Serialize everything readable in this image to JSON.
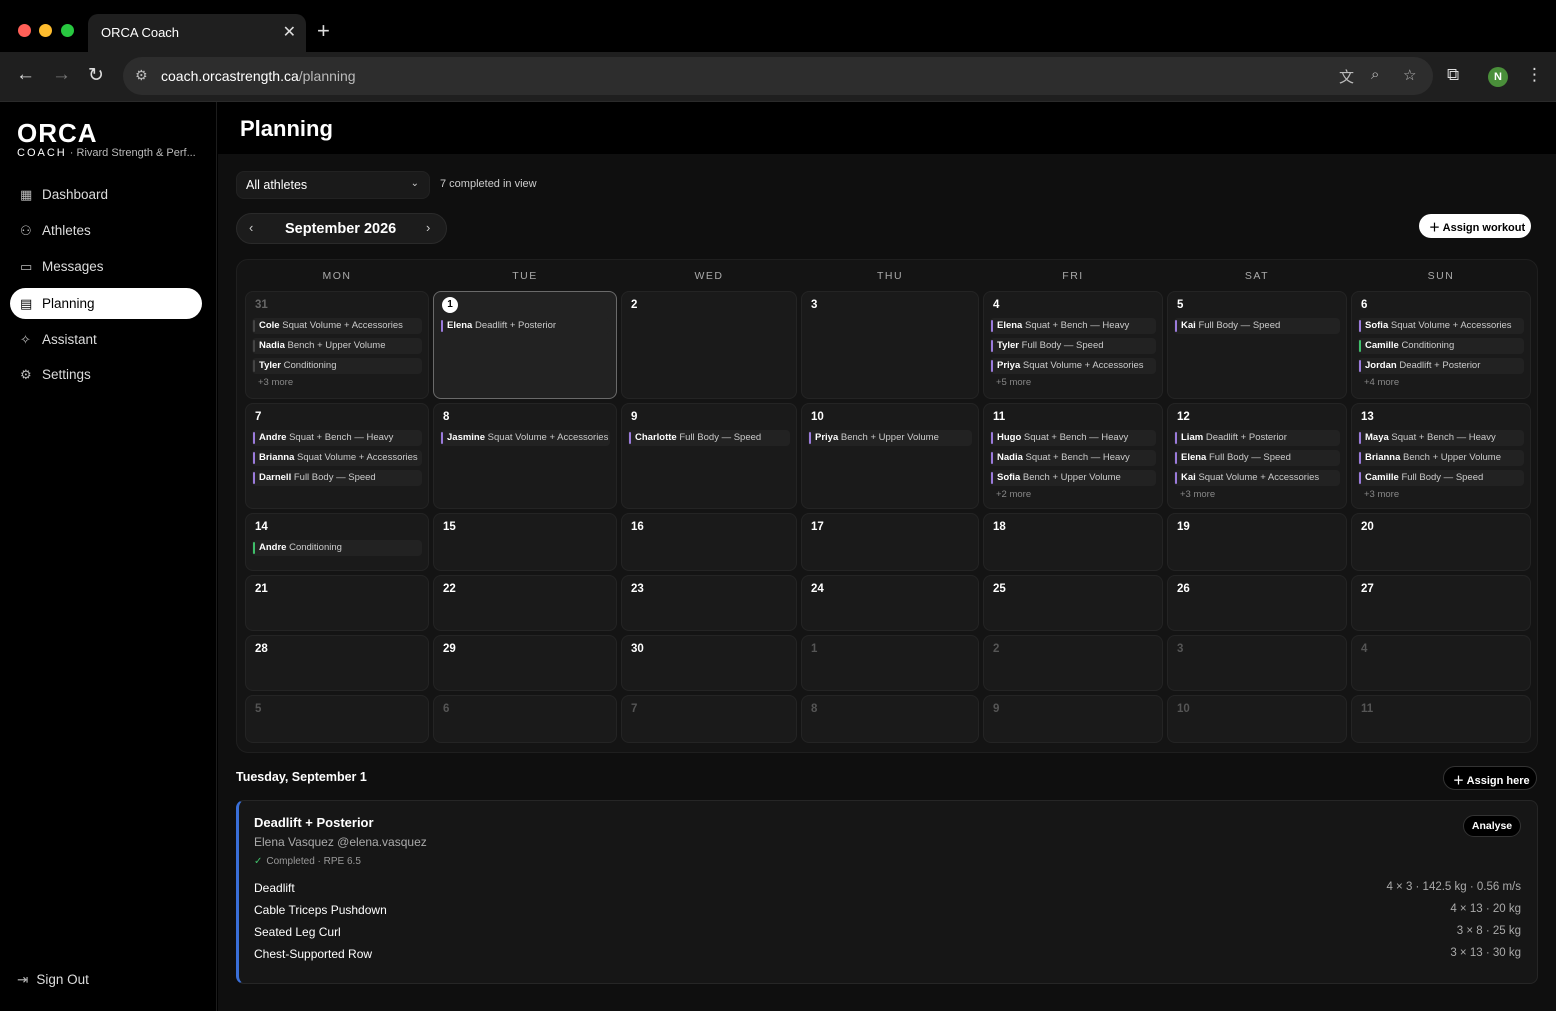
{
  "browser": {
    "tab_title": "ORCA Coach",
    "url_host": "coach.orcastrength.ca",
    "url_path": "/planning",
    "profile_initial": "N"
  },
  "sidebar": {
    "logo": "ORCA",
    "coach_label": "COACH",
    "org": "· Rivard Strength & Perf...",
    "items": [
      {
        "label": "Dashboard",
        "icon": "dashboard-icon"
      },
      {
        "label": "Athletes",
        "icon": "users-icon"
      },
      {
        "label": "Messages",
        "icon": "message-icon"
      },
      {
        "label": "Planning",
        "icon": "calendar-icon",
        "active": true
      },
      {
        "label": "Assistant",
        "icon": "sparkle-icon"
      },
      {
        "label": "Settings",
        "icon": "gear-icon"
      }
    ],
    "signout": "Sign Out"
  },
  "main": {
    "title": "Planning",
    "athlete_filter": "All athletes",
    "completed_text": "7 completed in view",
    "month": "September 2026",
    "assign_workout": "Assign workout"
  },
  "calendar": {
    "weekdays": [
      "MON",
      "TUE",
      "WED",
      "THU",
      "FRI",
      "SAT",
      "SUN"
    ],
    "weeks": [
      [
        {
          "day": "31",
          "state": "prev",
          "events": [
            {
              "athlete": "Cole",
              "workout": "Squat Volume + Accessories",
              "style": "plain"
            },
            {
              "athlete": "Nadia",
              "workout": "Bench + Upper Volume",
              "style": "plain"
            },
            {
              "athlete": "Tyler",
              "workout": "Conditioning",
              "style": "plain"
            }
          ],
          "more": "+3 more"
        },
        {
          "day": "1",
          "state": "today",
          "events": [
            {
              "athlete": "Elena",
              "workout": "Deadlift + Posterior",
              "style": "purple"
            }
          ],
          "more": ""
        },
        {
          "day": "2",
          "events": [],
          "more": ""
        },
        {
          "day": "3",
          "events": [],
          "more": ""
        },
        {
          "day": "4",
          "events": [
            {
              "athlete": "Elena",
              "workout": "Squat + Bench — Heavy",
              "style": "purple"
            },
            {
              "athlete": "Tyler",
              "workout": "Full Body — Speed",
              "style": "purple"
            },
            {
              "athlete": "Priya",
              "workout": "Squat Volume + Accessories",
              "style": "purple"
            }
          ],
          "more": "+5 more"
        },
        {
          "day": "5",
          "events": [
            {
              "athlete": "Kai",
              "workout": "Full Body — Speed",
              "style": "purple"
            }
          ],
          "more": ""
        },
        {
          "day": "6",
          "events": [
            {
              "athlete": "Sofia",
              "workout": "Squat Volume + Accessories",
              "style": "purple"
            },
            {
              "athlete": "Camille",
              "workout": "Conditioning",
              "style": "green"
            },
            {
              "athlete": "Jordan",
              "workout": "Deadlift + Posterior",
              "style": "purple"
            }
          ],
          "more": "+4 more"
        }
      ],
      [
        {
          "day": "7",
          "events": [
            {
              "athlete": "Andre",
              "workout": "Squat + Bench — Heavy",
              "style": "purple"
            },
            {
              "athlete": "Brianna",
              "workout": "Squat Volume + Accessories",
              "style": "purple"
            },
            {
              "athlete": "Darnell",
              "workout": "Full Body — Speed",
              "style": "purple"
            }
          ],
          "more": ""
        },
        {
          "day": "8",
          "events": [
            {
              "athlete": "Jasmine",
              "workout": "Squat Volume + Accessories",
              "style": "purple"
            }
          ],
          "more": ""
        },
        {
          "day": "9",
          "events": [
            {
              "athlete": "Charlotte",
              "workout": "Full Body — Speed",
              "style": "purple"
            }
          ],
          "more": ""
        },
        {
          "day": "10",
          "events": [
            {
              "athlete": "Priya",
              "workout": "Bench + Upper Volume",
              "style": "purple"
            }
          ],
          "more": ""
        },
        {
          "day": "11",
          "events": [
            {
              "athlete": "Hugo",
              "workout": "Squat + Bench — Heavy",
              "style": "purple"
            },
            {
              "athlete": "Nadia",
              "workout": "Squat + Bench — Heavy",
              "style": "purple"
            },
            {
              "athlete": "Sofia",
              "workout": "Bench + Upper Volume",
              "style": "purple"
            }
          ],
          "more": "+2 more"
        },
        {
          "day": "12",
          "events": [
            {
              "athlete": "Liam",
              "workout": "Deadlift + Posterior",
              "style": "purple"
            },
            {
              "athlete": "Elena",
              "workout": "Full Body — Speed",
              "style": "purple"
            },
            {
              "athlete": "Kai",
              "workout": "Squat Volume + Accessories",
              "style": "purple"
            }
          ],
          "more": "+3 more"
        },
        {
          "day": "13",
          "events": [
            {
              "athlete": "Maya",
              "workout": "Squat + Bench — Heavy",
              "style": "purple"
            },
            {
              "athlete": "Brianna",
              "workout": "Bench + Upper Volume",
              "style": "purple"
            },
            {
              "athlete": "Camille",
              "workout": "Full Body — Speed",
              "style": "purple"
            }
          ],
          "more": "+3 more"
        }
      ],
      [
        {
          "day": "14",
          "events": [
            {
              "athlete": "Andre",
              "workout": "Conditioning",
              "style": "green"
            }
          ],
          "more": ""
        },
        {
          "day": "15",
          "events": [],
          "more": ""
        },
        {
          "day": "16",
          "events": [],
          "more": ""
        },
        {
          "day": "17",
          "events": [],
          "more": ""
        },
        {
          "day": "18",
          "events": [],
          "more": ""
        },
        {
          "day": "19",
          "events": [],
          "more": ""
        },
        {
          "day": "20",
          "events": [],
          "more": ""
        }
      ],
      [
        {
          "day": "21",
          "events": [],
          "more": ""
        },
        {
          "day": "22",
          "events": [],
          "more": ""
        },
        {
          "day": "23",
          "events": [],
          "more": ""
        },
        {
          "day": "24",
          "events": [],
          "more": ""
        },
        {
          "day": "25",
          "events": [],
          "more": ""
        },
        {
          "day": "26",
          "events": [],
          "more": ""
        },
        {
          "day": "27",
          "events": [],
          "more": ""
        }
      ],
      [
        {
          "day": "28",
          "events": [],
          "more": ""
        },
        {
          "day": "29",
          "events": [],
          "more": ""
        },
        {
          "day": "30",
          "events": [],
          "more": ""
        },
        {
          "day": "1",
          "state": "other",
          "events": [],
          "more": ""
        },
        {
          "day": "2",
          "state": "other",
          "events": [],
          "more": ""
        },
        {
          "day": "3",
          "state": "other",
          "events": [],
          "more": ""
        },
        {
          "day": "4",
          "state": "other",
          "events": [],
          "more": ""
        }
      ],
      [
        {
          "day": "5",
          "state": "other",
          "events": [],
          "more": ""
        },
        {
          "day": "6",
          "state": "other",
          "events": [],
          "more": ""
        },
        {
          "day": "7",
          "state": "other",
          "events": [],
          "more": ""
        },
        {
          "day": "8",
          "state": "other",
          "events": [],
          "more": ""
        },
        {
          "day": "9",
          "state": "other",
          "events": [],
          "more": ""
        },
        {
          "day": "10",
          "state": "other",
          "events": [],
          "more": ""
        },
        {
          "day": "11",
          "state": "other",
          "events": [],
          "more": ""
        }
      ]
    ]
  },
  "selected_day": {
    "heading": "Tuesday, September 1",
    "assign_here": "Assign here",
    "workout": {
      "title": "Deadlift + Posterior",
      "athlete": "Elena Vasquez @elena.vasquez",
      "status": "Completed · RPE 6.5",
      "analyse": "Analyse",
      "accent": "#3a6fd8",
      "exercises": [
        {
          "name": "Deadlift",
          "detail": "4 × 3 · 142.5 kg · 0.56 m/s"
        },
        {
          "name": "Cable Triceps Pushdown",
          "detail": "4 × 13 · 20 kg"
        },
        {
          "name": "Seated Leg Curl",
          "detail": "3 × 8 · 25 kg"
        },
        {
          "name": "Chest-Supported Row",
          "detail": "3 × 13 · 30 kg"
        }
      ]
    }
  }
}
